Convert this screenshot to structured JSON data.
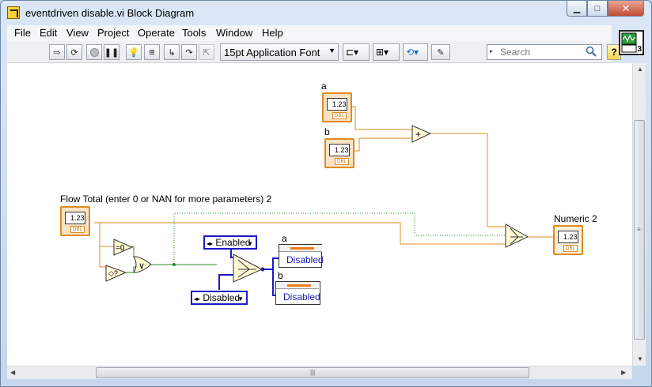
{
  "window": {
    "title": "eventdriven disable.vi Block Diagram"
  },
  "menu": [
    "File",
    "Edit",
    "View",
    "Project",
    "Operate",
    "Tools",
    "Window",
    "Help"
  ],
  "toolbar": {
    "font_selector": "15pt Application Font",
    "search_placeholder": "Search",
    "help_label": "?"
  },
  "vi_icon": {
    "connector_number": "3"
  },
  "diagram": {
    "control_a_label": "a",
    "control_b_label": "b",
    "flow_total_label": "Flow Total (enter 0 or NAN for more parameters) 2",
    "numeric2_label": "Numeric 2",
    "terminal_value": "1.23",
    "terminal_type": "DBL",
    "enabled_constant": "Enabled",
    "disabled_constant": "Disabled",
    "prop_a_label": "a",
    "prop_b_label": "b",
    "prop_a_value": "Disabled",
    "prop_b_value": "Disabled",
    "compare_zero_symbol": "=0",
    "or_symbol": "∨",
    "add_symbol": "+"
  },
  "colors": {
    "wire_numeric": "#e08a1f",
    "wire_boolean": "#2f8a2f",
    "wire_enum": "#1a1ac8",
    "canvas_bg": "#ffffff"
  }
}
